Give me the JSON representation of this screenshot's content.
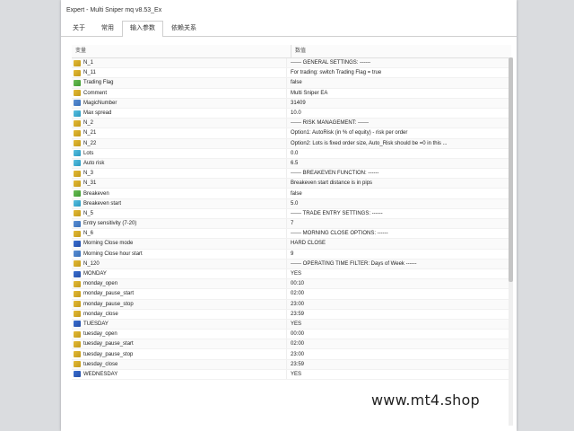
{
  "window": {
    "title": "Expert - Multi Sniper mq v8.53_Ex"
  },
  "tabs": [
    {
      "label": "关于",
      "active": false
    },
    {
      "label": "常用",
      "active": false
    },
    {
      "label": "输入参数",
      "active": true
    },
    {
      "label": "依赖关系",
      "active": false
    }
  ],
  "grid": {
    "col_variable": "变量",
    "col_value": "数值",
    "rows": [
      {
        "icon": "ab",
        "name": "N_1",
        "value": "------ GENERAL SETTINGS: ------"
      },
      {
        "icon": "ab",
        "name": "N_11",
        "value": "For trading: switch Trading Flag = true"
      },
      {
        "icon": "bool",
        "name": "Trading Flag",
        "value": "false"
      },
      {
        "icon": "ab",
        "name": "Comment",
        "value": "Multi Sniper EA"
      },
      {
        "icon": "num",
        "name": "MagicNumber",
        "value": "31409"
      },
      {
        "icon": "dbl",
        "name": "Max spread",
        "value": "10.0"
      },
      {
        "icon": "ab",
        "name": "N_2",
        "value": "------ RISK MANAGEMENT: ------"
      },
      {
        "icon": "ab",
        "name": "N_21",
        "value": "Option1: AutoRisk (in % of equity) - risk per order"
      },
      {
        "icon": "ab",
        "name": "N_22",
        "value": "Option2: Lots is fixed order size, Auto_Risk should be =0 in this ..."
      },
      {
        "icon": "dbl",
        "name": "Lots",
        "value": "0.0"
      },
      {
        "icon": "dbl",
        "name": "Auto risk",
        "value": "6.5"
      },
      {
        "icon": "ab",
        "name": "N_3",
        "value": "------ BREAKEVEN FUNCTION: ------"
      },
      {
        "icon": "ab",
        "name": "N_31",
        "value": "Breakeven start distance is in pips"
      },
      {
        "icon": "bool",
        "name": "Breakeven",
        "value": "false"
      },
      {
        "icon": "dbl",
        "name": "Breakeven start",
        "value": "5.0"
      },
      {
        "icon": "ab",
        "name": "N_5",
        "value": "------ TRADE ENTRY SETTINGS: ------"
      },
      {
        "icon": "num",
        "name": "Entry sensitivity (7-20)",
        "value": "7"
      },
      {
        "icon": "ab",
        "name": "N_6",
        "value": "------ MORNING CLOSE OPTIONS: ------"
      },
      {
        "icon": "enum",
        "name": "Morning Close mode",
        "value": "HARD CLOSE"
      },
      {
        "icon": "num",
        "name": "Morning Close hour start",
        "value": "9"
      },
      {
        "icon": "ab",
        "name": "N_120",
        "value": "------ OPERATING TIME FILTER: Days of Week ------"
      },
      {
        "icon": "enum",
        "name": "MONDAY",
        "value": "YES"
      },
      {
        "icon": "ab",
        "name": "monday_open",
        "value": "00:10"
      },
      {
        "icon": "ab",
        "name": "monday_pause_start",
        "value": "02:00"
      },
      {
        "icon": "ab",
        "name": "monday_pause_stop",
        "value": "23:00"
      },
      {
        "icon": "ab",
        "name": "monday_close",
        "value": "23:59"
      },
      {
        "icon": "enum",
        "name": "TUESDAY",
        "value": "YES"
      },
      {
        "icon": "ab",
        "name": "tuesday_open",
        "value": "00:00"
      },
      {
        "icon": "ab",
        "name": "tuesday_pause_start",
        "value": "02:00"
      },
      {
        "icon": "ab",
        "name": "tuesday_pause_stop",
        "value": "23:00"
      },
      {
        "icon": "ab",
        "name": "tuesday_close",
        "value": "23:59"
      },
      {
        "icon": "enum",
        "name": "WEDNESDAY",
        "value": "YES"
      }
    ]
  },
  "watermark": "www.mt4.shop"
}
